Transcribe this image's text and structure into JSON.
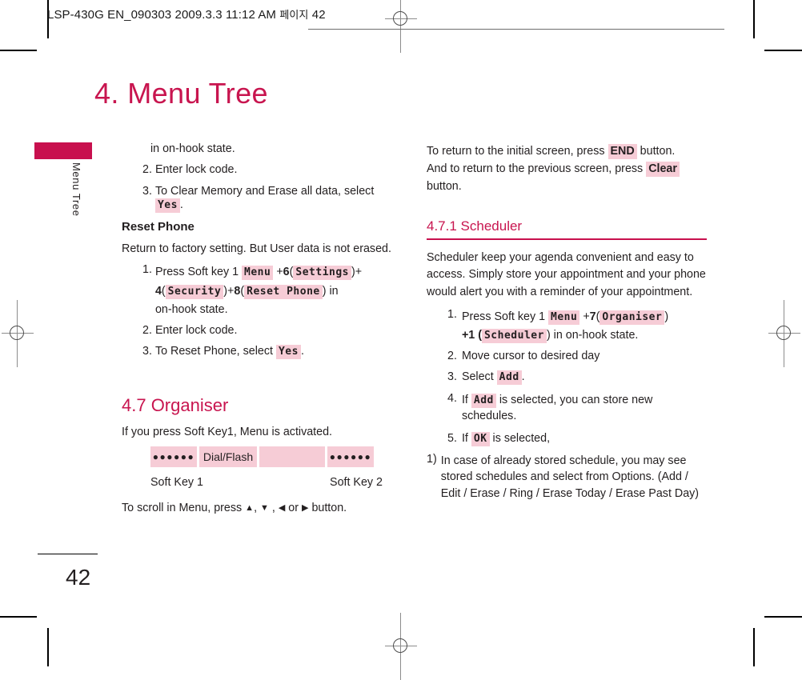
{
  "print_header": {
    "text": "LSP-430G EN_090303  2009.3.3 11:12 AM",
    "hangul": "페이지",
    "page_ref": "42"
  },
  "page_title": "4. Menu Tree",
  "side_tab": {
    "label": "Menu Tree"
  },
  "folio": "42",
  "colors": {
    "accent_magenta": "#c8104e",
    "heading_pink": "#c8154f",
    "highlight_pink": "#f6ccd6",
    "body_text": "#231f20"
  },
  "left_column": {
    "cont_line": "in on-hook state.",
    "cont_item2": {
      "num": "2.",
      "text": "Enter lock code."
    },
    "cont_item3": {
      "num": "3.",
      "text_before": "To Clear Memory and Erase all data, select",
      "chip": "Yes",
      "text_after": "."
    },
    "reset_phone": {
      "heading": "Reset Phone",
      "intro": "Return to factory setting. But User data is not erased.",
      "step1": {
        "num": "1.",
        "t1": "Press Soft key 1",
        "chip1": "Menu",
        "t2": "+",
        "b1": "6",
        "t3": "(",
        "chip2": "Settings",
        "t4": ")+",
        "b2": "4",
        "t5": "(",
        "chip3": "Security",
        "t6": ")+",
        "b3": "8",
        "t7": "(",
        "chip4": "Reset Phone",
        "t8": ") in",
        "t9": "on-hook state."
      },
      "step2": {
        "num": "2.",
        "text": "Enter lock code."
      },
      "step3": {
        "num": "3.",
        "text_before": "To Reset Phone, select",
        "chip": "Yes",
        "text_after": "."
      }
    },
    "organiser": {
      "heading": "4.7 Organiser",
      "intro": "If you press Soft Key1, Menu is activated.",
      "softkeys": [
        {
          "name": "softkey-left-dots",
          "label": "●●●●●●"
        },
        {
          "name": "softkey-dial-flash",
          "label": "Dial/Flash"
        },
        {
          "name": "softkey-blank",
          "label": ""
        },
        {
          "name": "softkey-right-dots",
          "label": "●●●●●●"
        }
      ],
      "softkey1_label": "Soft Key 1",
      "softkey2_label": "Soft Key 2",
      "scroll_before": "To scroll in Menu, press",
      "scroll_up": "▲",
      "scroll_down": "▼",
      "scroll_left": "◀",
      "scroll_or": "or",
      "scroll_right": "▶",
      "scroll_after": "button."
    }
  },
  "right_column": {
    "return_para": {
      "t1": "To return to the initial screen, press",
      "chip1": "END",
      "t2": "button.",
      "t3": "And to return to the previous screen, press",
      "chip2": "Clear",
      "t4": "button."
    },
    "scheduler": {
      "heading": "4.7.1 Scheduler",
      "intro": "Scheduler keep your agenda convenient and easy to access. Simply store your appointment and your phone would alert you with a reminder of your appointment.",
      "step1": {
        "num": "1.",
        "t1": "Press Soft key 1",
        "chip1": "Menu",
        "t2": "+",
        "b1": "7",
        "t3": "(",
        "chip2": "Organiser",
        "t4": ")",
        "t5": "+1 (",
        "chip3": "Scheduler",
        "t6": ") in on-hook state."
      },
      "step2": {
        "num": "2.",
        "text": "Move cursor to desired day"
      },
      "step3": {
        "num": "3.",
        "text_before": "Select",
        "chip": "Add",
        "text_after": "."
      },
      "step4": {
        "num": "4.",
        "text_before": "If",
        "chip": "Add",
        "text_after": "is selected, you can store new schedules."
      },
      "step5": {
        "num": "5.",
        "text_before": "If",
        "chip": "OK",
        "text_after": "is selected,"
      },
      "note1": {
        "num": "1)",
        "text": "In case of already stored schedule, you may see stored schedules and select from Options. (Add / Edit / Erase / Ring / Erase Today / Erase Past Day)"
      }
    }
  }
}
